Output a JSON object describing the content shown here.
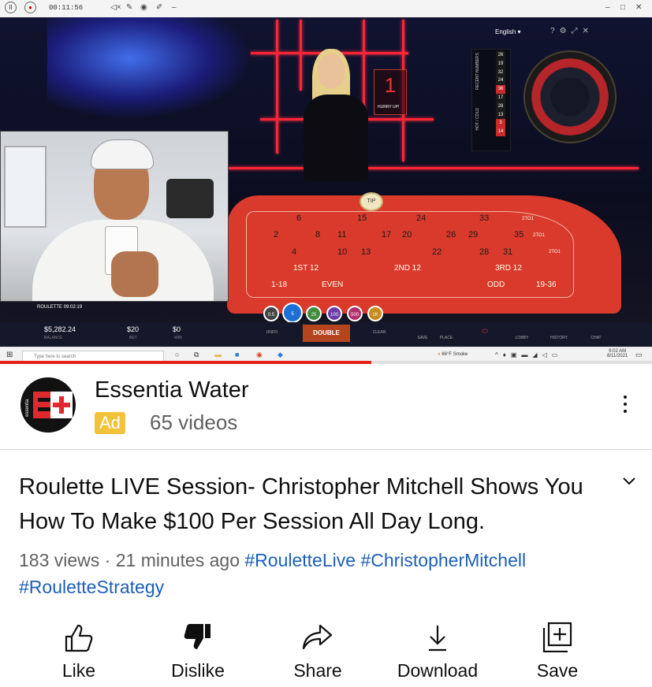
{
  "recorder": {
    "time": "00:11:56"
  },
  "game": {
    "language": "English",
    "recent_label": "RECENT NUMBERS",
    "hot_cold_label": "HOT / COLD",
    "recent_numbers": [
      "26",
      "19",
      "32",
      "24",
      "36",
      "17",
      "28",
      "13",
      "3",
      "14"
    ],
    "status_number": "1",
    "hurry_text": "HURRY UP!",
    "tip_label": "TIP",
    "table_numbers_row1": [
      "6",
      "15",
      "24",
      "33"
    ],
    "table_numbers_row2": [
      "2",
      "8",
      "11",
      "17",
      "20",
      "26",
      "29",
      "35"
    ],
    "table_numbers_row3": [
      "4",
      "10",
      "13",
      "22",
      "28",
      "31"
    ],
    "col_label": "2TO1",
    "dozen1": "1ST 12",
    "dozen2": "2ND 12",
    "dozen3": "3RD 12",
    "low": "1-18",
    "even": "EVEN",
    "odd": "ODD",
    "high": "19-36",
    "chips": [
      "0.5",
      "5",
      "25",
      "100",
      "500",
      "1K"
    ],
    "roulette_label": "ROULETTE",
    "roulette_time": "09:02:19",
    "balance_value": "$5,282.24",
    "balance_label": "BALANCE",
    "bet_value": "$20",
    "bet_label": "BET",
    "win_value": "$0",
    "win_label": "WIN",
    "undo": "UNDO",
    "double": "DOUBLE",
    "clear": "CLEAR",
    "save": "SAVE",
    "place": "PLACE",
    "lobby": "LOBBY",
    "history": "HISTORY",
    "chat": "CHAT"
  },
  "taskbar": {
    "search_placeholder": "Type here to search",
    "weather": "86°F Smoke",
    "clock_time": "9:02 AM",
    "clock_date": "8/11/2021"
  },
  "progress_fraction": 0.57,
  "channel": {
    "name": "Essentia Water",
    "ad_label": "Ad",
    "video_count": "65 videos",
    "avatar_text": "essentia"
  },
  "video": {
    "title": "Roulette LIVE Session- Christopher Mitchell Shows You How To Make $100 Per Session All Day Long.",
    "views": "183 views · 21 minutes ago",
    "hashtags": [
      "#RouletteLive",
      "#ChristopherMitchell",
      "#RouletteStrategy"
    ]
  },
  "actions": {
    "like": "Like",
    "dislike": "Dislike",
    "share": "Share",
    "download": "Download",
    "save": "Save"
  },
  "colors": {
    "accent_red": "#e62117",
    "link_blue": "#1c5fb8",
    "ad_yellow": "#f3c23b"
  }
}
